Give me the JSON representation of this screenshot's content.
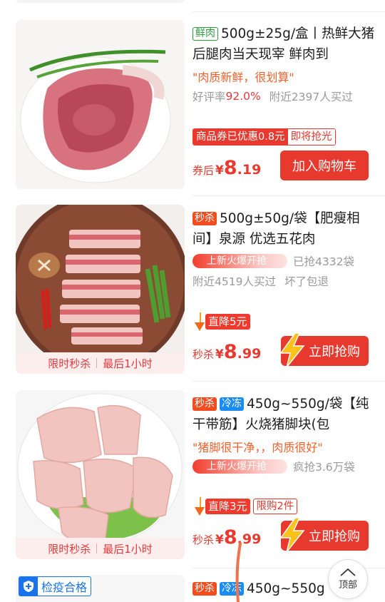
{
  "products": [
    {
      "tags": [
        "鲜肉"
      ],
      "title": "500g±25g/盒丨热鲜大猪后腿肉当天现宰 鲜肉到",
      "quote": "\"肉质新鲜，很划算\"",
      "rating_label": "好评率",
      "rating_value": "92.0%",
      "nearby": "附近2397人买过",
      "coupon_label": "商品券已优惠0.8元",
      "coupon_tag": "即将抢光",
      "price_label": "券后",
      "currency": "¥",
      "price_int": "8",
      "price_dec": ".19",
      "button": "加入购物车"
    },
    {
      "tags": [
        "秒杀"
      ],
      "title": "500g±50g/袋【肥瘦相间】泉源 优选五花肉",
      "hot_label": "上新火爆开抢",
      "sold": "已抢4332袋",
      "nearby": "附近4519人买过",
      "guarantee": "坏了包退",
      "drop_label": "直降5元",
      "price_label": "秒杀",
      "currency": "¥",
      "price_int": "8",
      "price_dec": ".99",
      "button": "立即抢购",
      "flash_left": "限时秒杀",
      "flash_right": "最后1小时"
    },
    {
      "tags": [
        "秒杀",
        "冷冻"
      ],
      "title": "450g~550g/袋【纯干带筋】火烧猪脚块(包",
      "quote": "\"猪脚很干净，，肉质很好\"",
      "hot_label": "上新火爆开抢",
      "sold": "疯抢3.6万袋",
      "drop_label": "直降3元",
      "limit_label": "限购2件",
      "price_label": "秒杀",
      "currency": "¥",
      "price_int": "8",
      "price_dec": ".99",
      "button": "立即抢购",
      "flash_left": "限时秒杀",
      "flash_right": "最后1小时"
    },
    {
      "badge": "检疫合格",
      "tags": [
        "秒杀",
        "冷冻"
      ],
      "title": "450g~550g"
    }
  ],
  "back_to_top": "顶部",
  "colors": {
    "accent_red": "#e8392f",
    "fresh_green": "#2d9b3c",
    "frozen_blue": "#1a8cf2",
    "badge_blue": "#1a73e8"
  }
}
